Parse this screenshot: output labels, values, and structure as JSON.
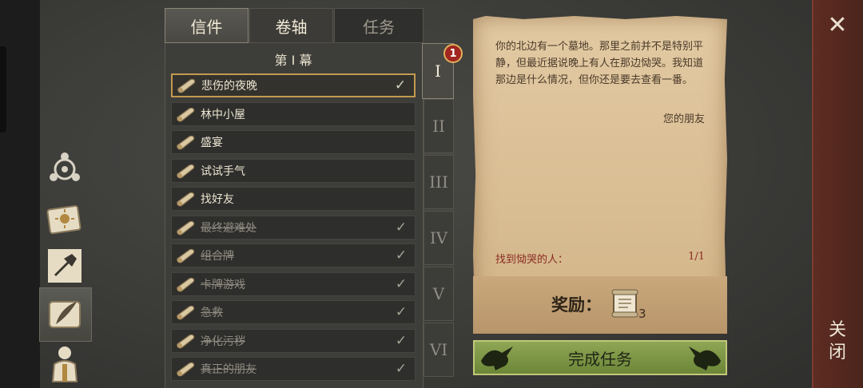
{
  "tabs": [
    {
      "label": "信件",
      "active": true
    },
    {
      "label": "卷轴",
      "active": false
    },
    {
      "label": "任务",
      "active": false
    }
  ],
  "act_title": "第 I 幕",
  "chapters": [
    "I",
    "II",
    "III",
    "IV",
    "V",
    "VI"
  ],
  "notification_badge": "1",
  "quests": [
    {
      "title": "悲伤的夜晚",
      "done": false,
      "selected": true,
      "checked": true
    },
    {
      "title": "林中小屋",
      "done": false,
      "selected": false,
      "checked": false
    },
    {
      "title": "盛宴",
      "done": false,
      "selected": false,
      "checked": false
    },
    {
      "title": "试试手气",
      "done": false,
      "selected": false,
      "checked": false
    },
    {
      "title": "找好友",
      "done": false,
      "selected": false,
      "checked": false
    },
    {
      "title": "最终避难处",
      "done": true,
      "selected": false,
      "checked": true
    },
    {
      "title": "组合牌",
      "done": true,
      "selected": false,
      "checked": true
    },
    {
      "title": "卡牌游戏",
      "done": true,
      "selected": false,
      "checked": true
    },
    {
      "title": "急救",
      "done": true,
      "selected": false,
      "checked": true
    },
    {
      "title": "净化污秽",
      "done": true,
      "selected": false,
      "checked": true
    },
    {
      "title": "真正的朋友",
      "done": true,
      "selected": false,
      "checked": true
    }
  ],
  "letter": {
    "body": "你的北边有一个墓地。那里之前并不是特别平静，但最近据说晚上有人在那边恸哭。我知道那边是什么情况，但你还是要去查看一番。",
    "signature": "您的朋友",
    "objective": "找到恸哭的人：",
    "objective_progress": "1/1"
  },
  "reward": {
    "label": "奖励：",
    "count": "3",
    "icon": "scroll-reward-icon"
  },
  "complete_button": "完成任务",
  "close": {
    "symbol": "✕",
    "label": "关闭"
  },
  "colors": {
    "accent_gold": "#c39a50",
    "button_green": "#7c9646",
    "close_red": "#5e2c22",
    "badge_red": "#a0261f"
  }
}
